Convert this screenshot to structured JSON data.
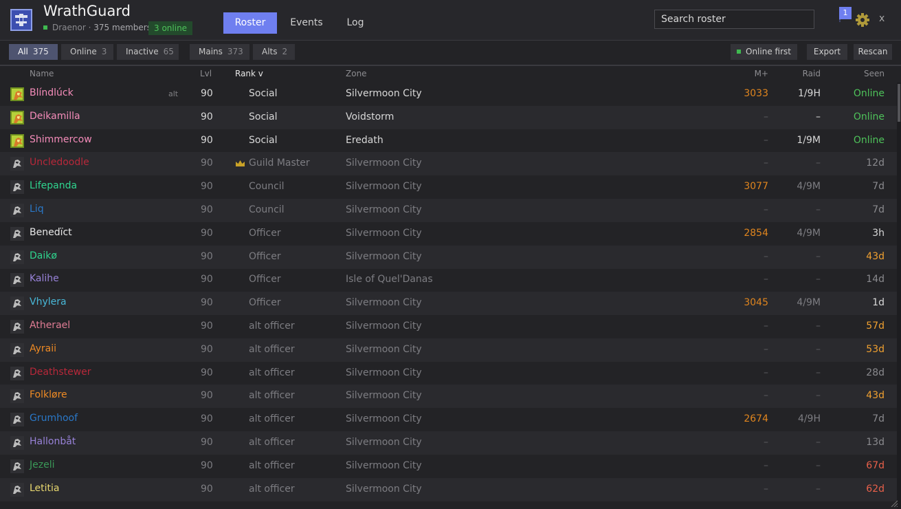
{
  "app": {
    "title": "WrathGuard",
    "realm": "Draenor",
    "members": "375 members",
    "online_badge": "3 online",
    "subtitle_sep": "·"
  },
  "tabs": [
    {
      "label": "Roster",
      "active": true
    },
    {
      "label": "Events"
    },
    {
      "label": "Log"
    }
  ],
  "search": {
    "placeholder": "Search roster"
  },
  "notifications": {
    "count": "1",
    "mark": "!"
  },
  "window": {
    "close_label": "x"
  },
  "filters": [
    {
      "label": "All",
      "count": "375",
      "active": true
    },
    {
      "label": "Online",
      "count": "3"
    },
    {
      "label": "Inactive",
      "count": "65"
    },
    {
      "label": "Mains",
      "count": "373"
    },
    {
      "label": "Alts",
      "count": "2"
    }
  ],
  "actions": {
    "online_first": "Online first",
    "export": "Export",
    "rescan": "Rescan"
  },
  "columns": {
    "name": "Name",
    "lvl": "Lvl",
    "rank": "Rank v",
    "zone": "Zone",
    "mplus": "M+",
    "raid": "Raid",
    "seen": "Seen"
  },
  "dash": "–",
  "colors": {
    "accent": "#6f7ff0",
    "online": "#4ec25a",
    "mplus": "#e0851e",
    "seen_warn": "#f0a030",
    "seen_stale": "#e8604a"
  },
  "rows": [
    {
      "name": "Blíndlúck",
      "color": "#f58cba",
      "alt": "alt",
      "lvl": "90",
      "rank": "Social",
      "zone": "Silvermoon City",
      "mplus": "3033",
      "raid": "1/9H",
      "seen": "Online",
      "seen_color": "#4ec25a",
      "online": true,
      "icon": "dragon-portrait-icon"
    },
    {
      "name": "Deikamilla",
      "color": "#f58cba",
      "lvl": "90",
      "rank": "Social",
      "zone": "Voidstorm",
      "mplus": "",
      "raid": "",
      "seen": "Online",
      "seen_color": "#4ec25a",
      "online": true,
      "icon": "dragon-portrait-icon"
    },
    {
      "name": "Shimmercow",
      "color": "#f58cba",
      "lvl": "90",
      "rank": "Social",
      "zone": "Eredath",
      "mplus": "",
      "raid": "1/9M",
      "seen": "Online",
      "seen_color": "#4ec25a",
      "online": true,
      "icon": "dragon-portrait-icon"
    },
    {
      "name": "Uncledoodle",
      "color": "#b8283a",
      "lvl": "90",
      "rank": "Guild Master",
      "crown": true,
      "zone": "Silvermoon City",
      "mplus": "",
      "raid": "",
      "seen": "12d",
      "seen_color": "#8a8a8e",
      "icon": "beast-portrait-icon"
    },
    {
      "name": "Lifepanda",
      "color": "#2fd58f",
      "lvl": "90",
      "rank": "Council",
      "zone": "Silvermoon City",
      "mplus": "3077",
      "raid": "4/9M",
      "seen": "7d",
      "seen_color": "#8a8a8e",
      "icon": "beast-portrait-icon"
    },
    {
      "name": "Liq",
      "color": "#2a78c8",
      "lvl": "90",
      "rank": "Council",
      "zone": "Silvermoon City",
      "mplus": "",
      "raid": "",
      "seen": "7d",
      "seen_color": "#8a8a8e",
      "icon": "beast-portrait-icon"
    },
    {
      "name": "Benedïct",
      "color": "#e8e8e8",
      "lvl": "90",
      "rank": "Officer",
      "zone": "Silvermoon City",
      "mplus": "2854",
      "raid": "4/9M",
      "seen": "3h",
      "seen_color": "#d8d8d8",
      "icon": "beast-portrait-icon"
    },
    {
      "name": "Daikø",
      "color": "#2fd58f",
      "lvl": "90",
      "rank": "Officer",
      "zone": "Silvermoon City",
      "mplus": "",
      "raid": "",
      "seen": "43d",
      "seen_color": "#f0a030",
      "icon": "beast-portrait-icon"
    },
    {
      "name": "Kalihe",
      "color": "#9882d8",
      "lvl": "90",
      "rank": "Officer",
      "zone": "Isle of Quel'Danas",
      "mplus": "",
      "raid": "",
      "seen": "14d",
      "seen_color": "#8a8a8e",
      "icon": "beast-portrait-icon"
    },
    {
      "name": "Vhylera",
      "color": "#48b8d8",
      "lvl": "90",
      "rank": "Officer",
      "zone": "Silvermoon City",
      "mplus": "3045",
      "raid": "4/9M",
      "seen": "1d",
      "seen_color": "#d8d8d8",
      "icon": "beast-portrait-icon"
    },
    {
      "name": "Atherael",
      "color": "#e07c94",
      "lvl": "90",
      "rank": "alt officer",
      "zone": "Silvermoon City",
      "mplus": "",
      "raid": "",
      "seen": "57d",
      "seen_color": "#f0a030",
      "icon": "beast-portrait-icon"
    },
    {
      "name": "Ayraii",
      "color": "#ee8a24",
      "lvl": "90",
      "rank": "alt officer",
      "zone": "Silvermoon City",
      "mplus": "",
      "raid": "",
      "seen": "53d",
      "seen_color": "#f0a030",
      "icon": "beast-portrait-icon"
    },
    {
      "name": "Deathstewer",
      "color": "#b8283a",
      "lvl": "90",
      "rank": "alt officer",
      "zone": "Silvermoon City",
      "mplus": "",
      "raid": "",
      "seen": "28d",
      "seen_color": "#8a8a8e",
      "icon": "beast-portrait-icon"
    },
    {
      "name": "Folkløre",
      "color": "#ee8a24",
      "lvl": "90",
      "rank": "alt officer",
      "zone": "Silvermoon City",
      "mplus": "",
      "raid": "",
      "seen": "43d",
      "seen_color": "#f0a030",
      "icon": "beast-portrait-icon"
    },
    {
      "name": "Grumhoof",
      "color": "#2a78c8",
      "lvl": "90",
      "rank": "alt officer",
      "zone": "Silvermoon City",
      "mplus": "2674",
      "raid": "4/9H",
      "seen": "7d",
      "seen_color": "#8a8a8e",
      "icon": "beast-portrait-icon"
    },
    {
      "name": "Hallonbåt",
      "color": "#9882d8",
      "lvl": "90",
      "rank": "alt officer",
      "zone": "Silvermoon City",
      "mplus": "",
      "raid": "",
      "seen": "13d",
      "seen_color": "#8a8a8e",
      "icon": "beast-portrait-icon"
    },
    {
      "name": "Jezeli",
      "color": "#3a9a58",
      "lvl": "90",
      "rank": "alt officer",
      "zone": "Silvermoon City",
      "mplus": "",
      "raid": "",
      "seen": "67d",
      "seen_color": "#e8604a",
      "icon": "beast-portrait-icon"
    },
    {
      "name": "Letitia",
      "color": "#e8d870",
      "lvl": "90",
      "rank": "alt officer",
      "zone": "Silvermoon City",
      "mplus": "",
      "raid": "",
      "seen": "62d",
      "seen_color": "#e8604a",
      "icon": "beast-portrait-icon"
    }
  ]
}
